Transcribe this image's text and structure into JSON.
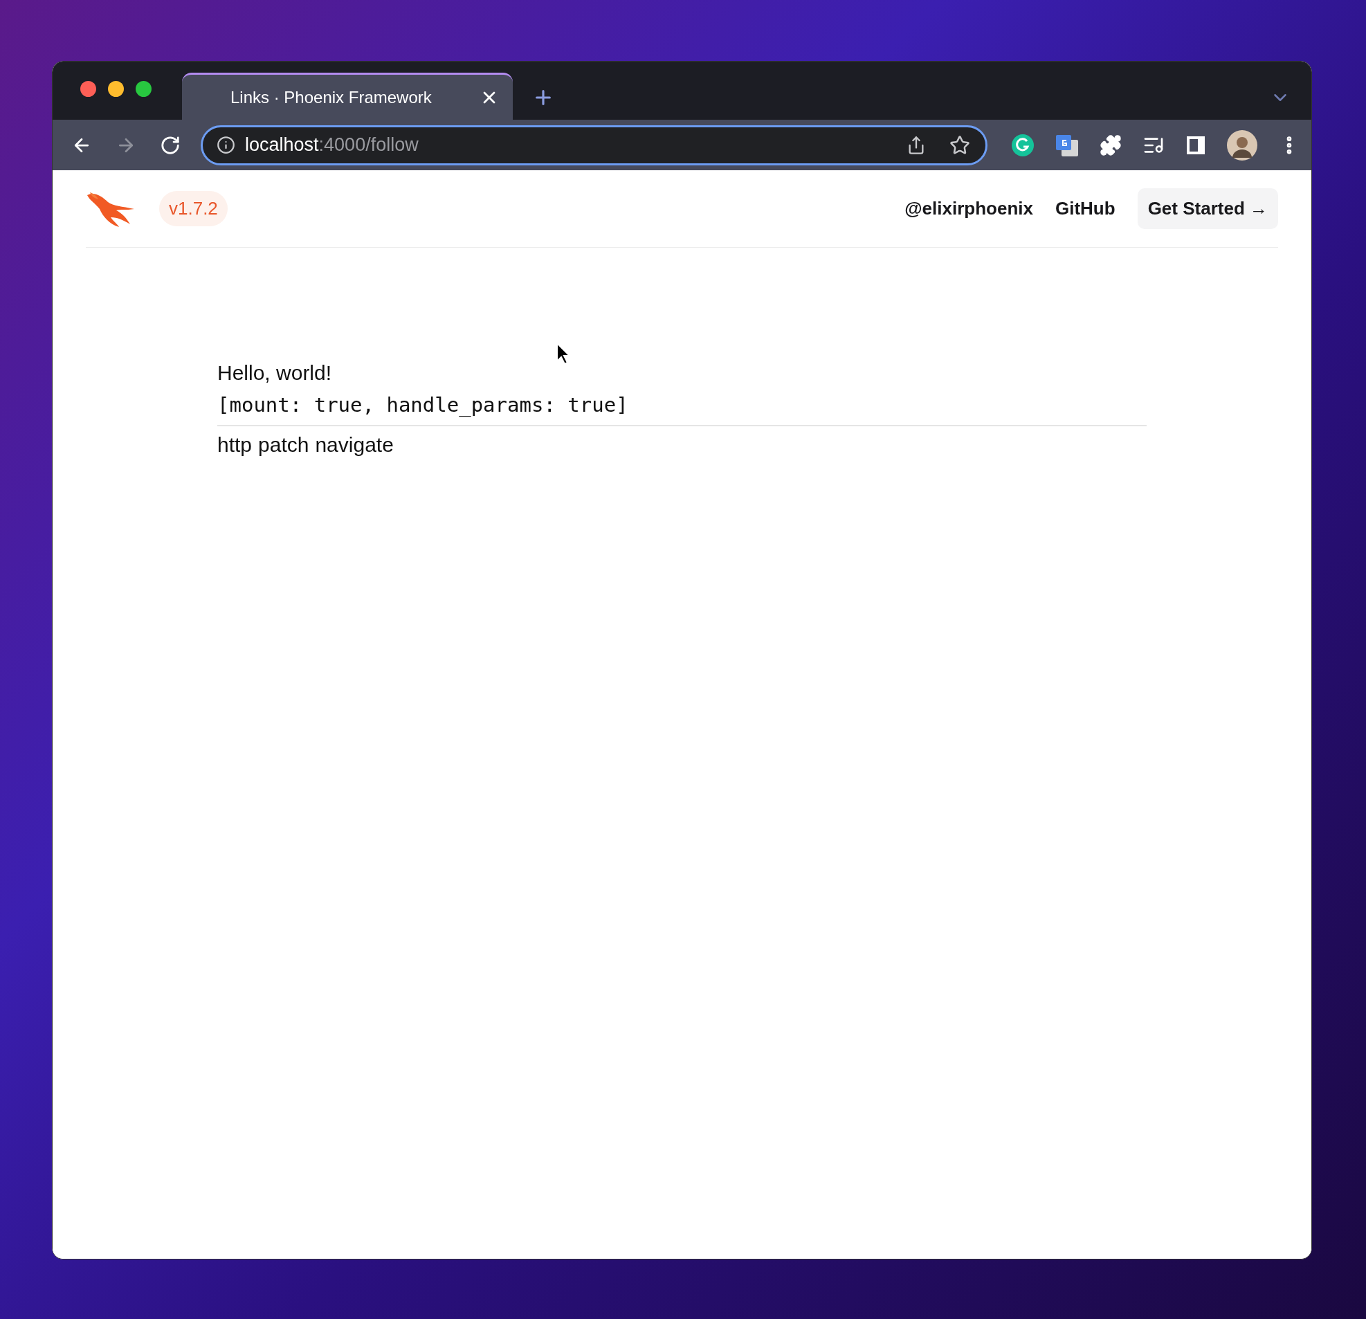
{
  "browser": {
    "tabs": [
      {
        "title": "Links · Phoenix Framework",
        "selected": true
      }
    ],
    "nav_buttons": [
      {
        "kind": "back",
        "disabled": false
      },
      {
        "kind": "forward",
        "disabled": true
      },
      {
        "kind": "reload",
        "disabled": false
      }
    ],
    "address": {
      "host": "localhost",
      "path": ":4000/follow"
    }
  },
  "page": {
    "version": "v1.7.2",
    "nav": [
      "@elixirphoenix",
      "GitHub"
    ],
    "cta": "Get Started →",
    "greeting": "Hello, world!",
    "state": "[mount: true, handle_params: true]",
    "links": [
      "http",
      "patch",
      "navigate"
    ]
  }
}
